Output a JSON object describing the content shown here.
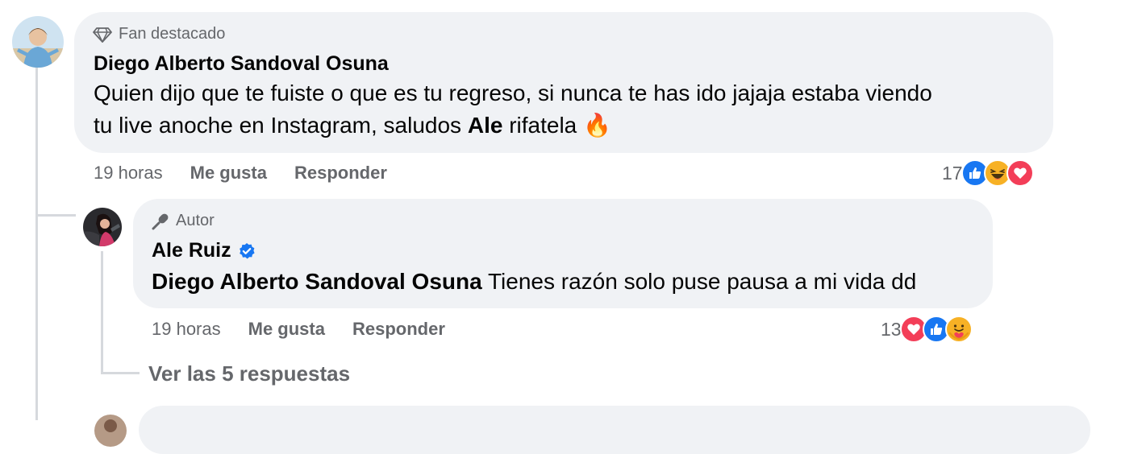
{
  "comment": {
    "badge": "Fan destacado",
    "author": "Diego Alberto Sandoval Osuna",
    "text_part1": "Quien dijo que te fuiste o que es tu regreso, si nunca te has ido jajaja estaba viendo",
    "text_part2": "tu live anoche en Instagram, saludos",
    "mention": "Ale",
    "text_part3": "rifatela",
    "emoji": "🔥",
    "time": "19 horas",
    "like_label": "Me gusta",
    "reply_label": "Responder",
    "reaction_count": "17",
    "reactions": [
      "like-icon",
      "haha-icon",
      "love-icon"
    ]
  },
  "reply": {
    "badge": "Autor",
    "author": "Ale Ruiz",
    "verified": true,
    "mention": "Diego Alberto Sandoval Osuna",
    "text": "Tienes razón solo puse pausa a mi vida dd",
    "time": "19 horas",
    "like_label": "Me gusta",
    "reply_label": "Responder",
    "reaction_count": "13",
    "reactions": [
      "love-icon",
      "like-icon",
      "care-icon"
    ]
  },
  "more_replies": "Ver las 5 respuestas",
  "colors": {
    "bubble": "#f0f2f5",
    "secondary_text": "#65676b",
    "like_blue": "#1877f2",
    "love_red": "#f33e58",
    "haha_yellow": "#f7b125"
  }
}
